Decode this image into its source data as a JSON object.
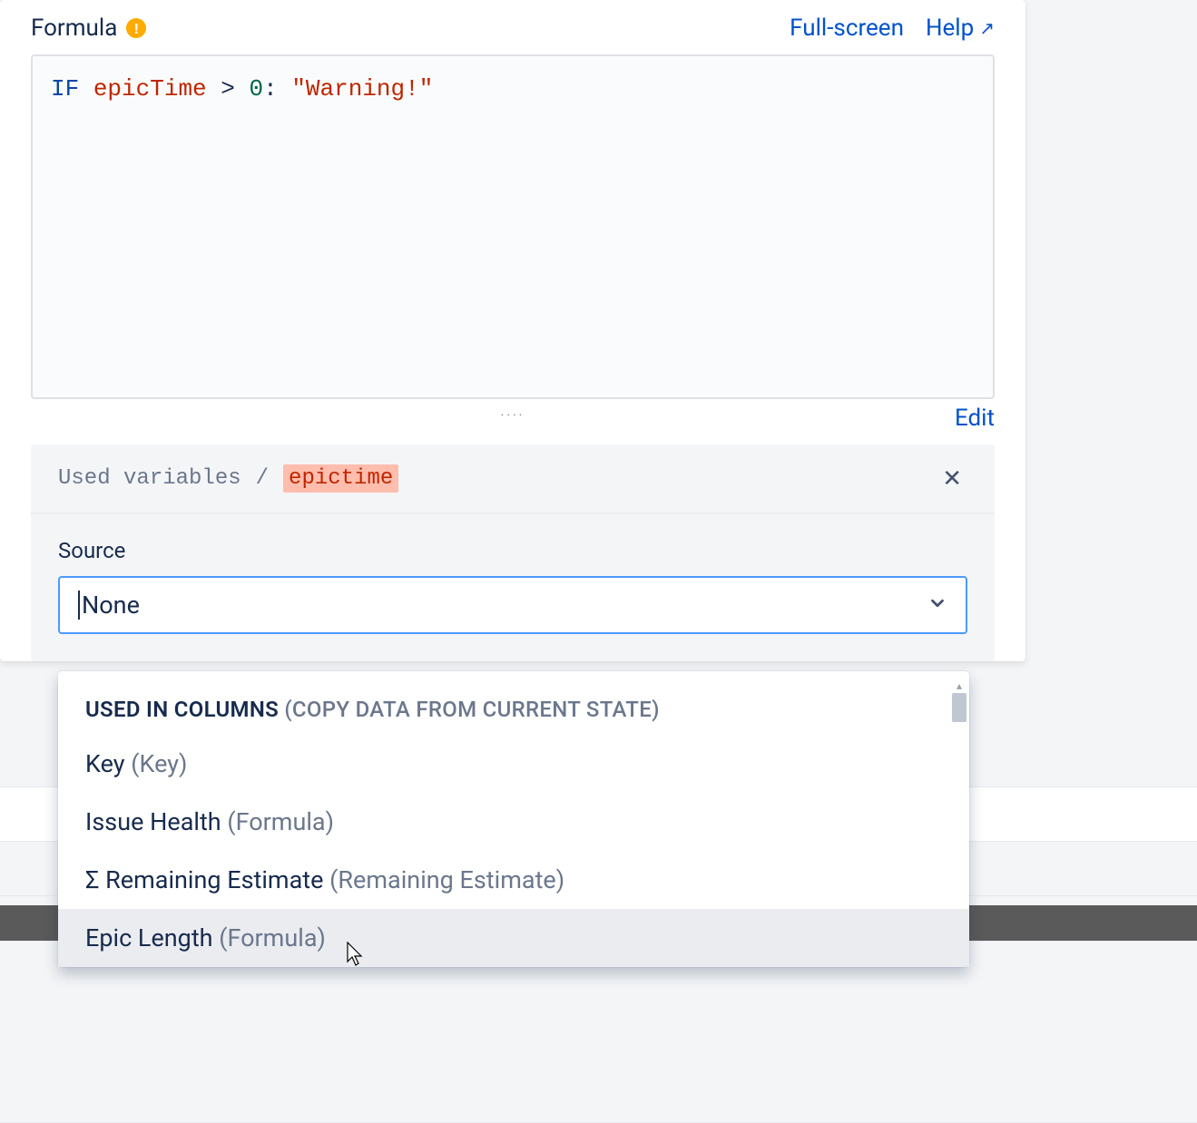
{
  "header": {
    "title": "Formula",
    "warning_glyph": "!",
    "fullscreen_label": "Full-screen",
    "help_label": "Help",
    "help_arrow": "↗"
  },
  "formula": {
    "kw": "IF",
    "var": "epicTime",
    "op1": ">",
    "num": "0",
    "colon": ":",
    "str": "\"Warning!\""
  },
  "footer": {
    "drag_dots": "····",
    "edit_label": "Edit"
  },
  "variables": {
    "breadcrumb_label": "Used variables",
    "separator": "/",
    "current_var": "epictime",
    "close_glyph": "✕",
    "source_label": "Source",
    "dropdown_value": "None",
    "caret": "⌄"
  },
  "dropdown": {
    "section_title": "USED IN COLUMNS",
    "section_sub": "(COPY DATA FROM CURRENT STATE)",
    "options": [
      {
        "name": "Key",
        "type": "(Key)"
      },
      {
        "name": "Issue Health",
        "type": "(Formula)"
      },
      {
        "name": "Σ Remaining Estimate",
        "type": "(Remaining Estimate)"
      },
      {
        "name": "Epic Length",
        "type": "(Formula)"
      }
    ],
    "scroll_up": "▴"
  }
}
